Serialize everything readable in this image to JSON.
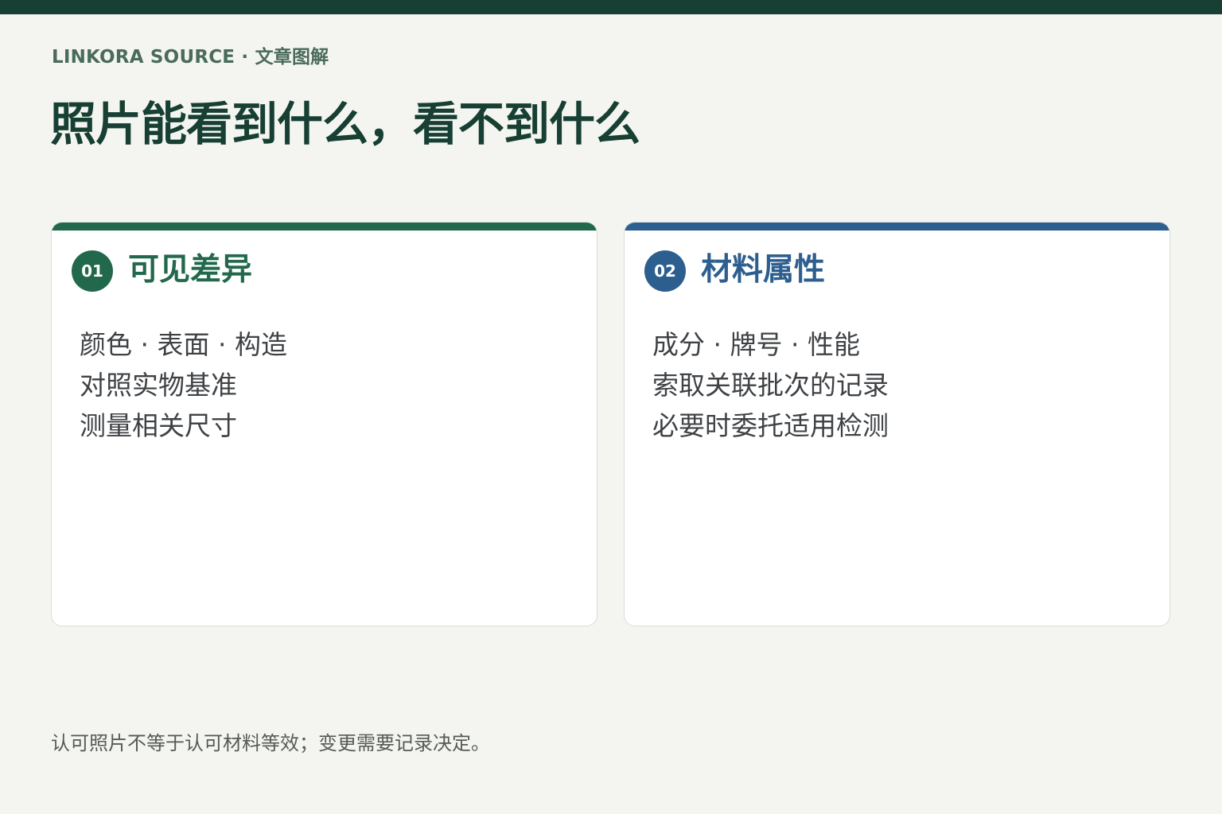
{
  "colors": {
    "background": "#f4f5f0",
    "top_band": "#173f33",
    "title": "#173f33",
    "eyebrow": "#4a6b5c",
    "card_green": "#22684c",
    "card_blue": "#2c5e8f",
    "body_text": "#3f4245"
  },
  "header": {
    "eyebrow": "LINKORA SOURCE · 文章图解",
    "title": "照片能看到什么，看不到什么"
  },
  "cards": [
    {
      "number": "01",
      "title": "可见差异",
      "accent": "#22684c",
      "lines": [
        "颜色 · 表面 · 构造",
        "对照实物基准",
        "测量相关尺寸"
      ]
    },
    {
      "number": "02",
      "title": "材料属性",
      "accent": "#2c5e8f",
      "lines": [
        "成分 · 牌号 · 性能",
        "索取关联批次的记录",
        "必要时委托适用检测"
      ]
    }
  ],
  "footer": {
    "note": "认可照片不等于认可材料等效；变更需要记录决定。"
  }
}
